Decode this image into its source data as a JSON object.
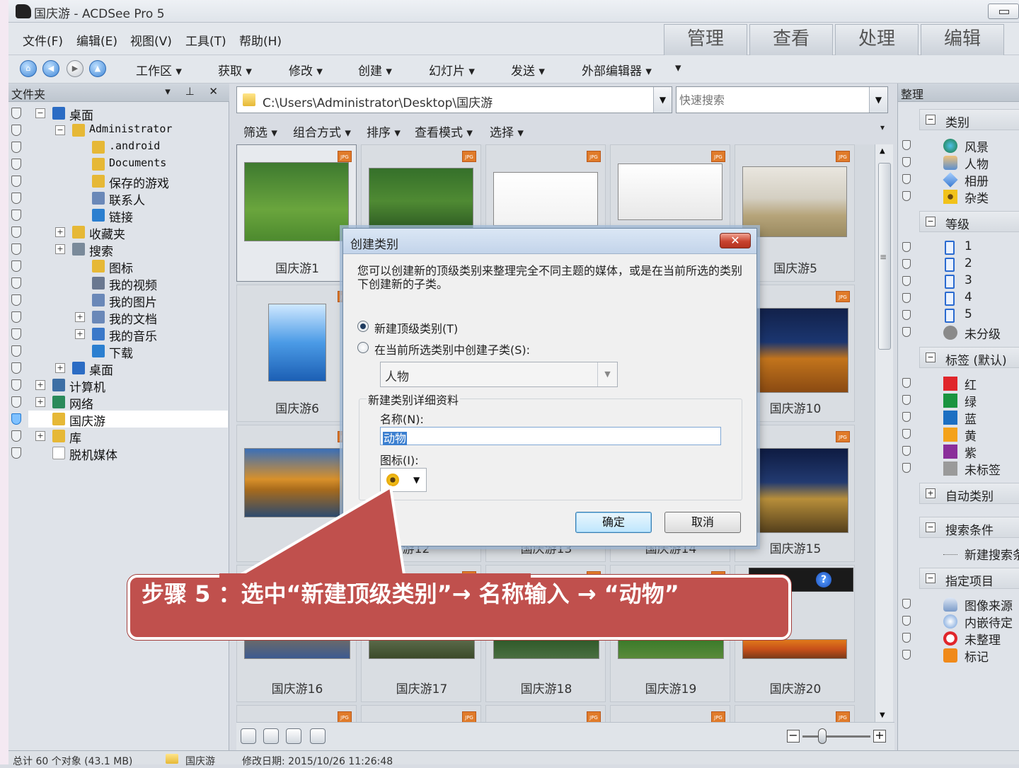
{
  "window": {
    "title": "国庆游 - ACDSee Pro 5"
  },
  "menu": {
    "items": [
      "文件(F)",
      "编辑(E)",
      "视图(V)",
      "工具(T)",
      "帮助(H)"
    ]
  },
  "modes": [
    "管理",
    "查看",
    "处理",
    "编辑"
  ],
  "toolbar": {
    "items": [
      "工作区 ▾",
      "获取 ▾",
      "修改 ▾",
      "创建 ▾",
      "幻灯片 ▾",
      "发送 ▾",
      "外部编辑器 ▾"
    ]
  },
  "left_panel": {
    "title": "文件夹",
    "controls": "▾ ⊥ ✕",
    "tree": [
      "桌面",
      "Administrator",
      ".android",
      "Documents",
      "保存的游戏",
      "联系人",
      "链接",
      "收藏夹",
      "搜索",
      "图标",
      "我的视频",
      "我的图片",
      "我的文档",
      "我的音乐",
      "下载",
      "桌面",
      "计算机",
      "网络",
      "国庆游",
      "库",
      "脱机媒体"
    ]
  },
  "address": {
    "path": "C:\\Users\\Administrator\\Desktop\\国庆游",
    "search_placeholder": "快速搜索"
  },
  "filterbar": {
    "items": [
      "筛选 ▾",
      "组合方式 ▾",
      "排序 ▾",
      "查看模式 ▾",
      "选择 ▾"
    ]
  },
  "thumbs": {
    "badge": "JPG",
    "labels": [
      "国庆游1",
      "",
      "",
      "",
      "国庆游5",
      "国庆游6",
      "",
      "",
      "",
      "国庆游10",
      "国",
      "游12",
      "国庆游13",
      "国庆游14",
      "国庆游15",
      "国庆游16",
      "国庆游17",
      "国庆游18",
      "国庆游19",
      "国庆游20"
    ]
  },
  "right_panel": {
    "title": "整理",
    "sections": {
      "category": "类别",
      "rating": "等级",
      "labels": "标签 (默认)",
      "auto": "自动类别",
      "search": "搜索条件",
      "special": "指定项目"
    },
    "categories": [
      "风景",
      "人物",
      "相册",
      "杂类"
    ],
    "ratings": [
      "1",
      "2",
      "3",
      "4",
      "5",
      "未分级"
    ],
    "label_items": [
      "红",
      "绿",
      "蓝",
      "黄",
      "紫",
      "未标签"
    ],
    "label_colors": [
      "#e0262b",
      "#1a9440",
      "#1c6fc2",
      "#f4a21a",
      "#8a2f9a",
      "#9a9a9a"
    ],
    "search_items": [
      "新建搜索条"
    ],
    "special_items": [
      "图像来源",
      "内嵌待定",
      "未整理",
      "标记"
    ]
  },
  "status": {
    "count": "总计 60 个对象 (43.1 MB)",
    "folder": "国庆游",
    "modified": "修改日期: 2015/10/26 11:26:48"
  },
  "dialog": {
    "title": "创建类别",
    "close": "✕",
    "description": "您可以创建新的顶级类别来整理完全不同主题的媒体，或是在当前所选的类别下创建新的子类。",
    "option_top": "新建顶级类别(T)",
    "option_sub": "在当前所选类别中创建子类(S):",
    "parent_value": "人物",
    "group_title": "新建类别详细资料",
    "name_label": "名称(N):",
    "name_value": "动物",
    "icon_label": "图标(I):",
    "ok": "确定",
    "cancel": "取消"
  },
  "callout": {
    "text": "步骤 5 ：选中“新建顶级类别”→  名称输入 →  “动物”",
    "color": "#c0504d"
  }
}
